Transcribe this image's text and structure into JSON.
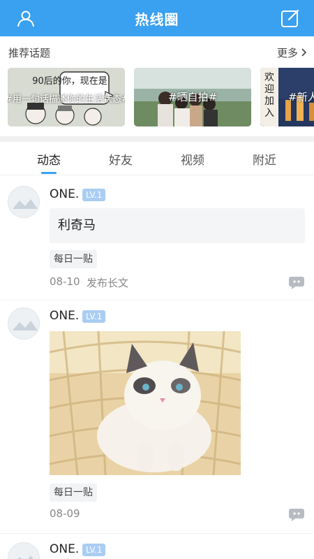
{
  "header": {
    "title": "热线圈",
    "left_icon": "user-icon",
    "right_icon": "compose-icon"
  },
  "topics": {
    "label": "推荐话题",
    "more": "更多",
    "cards": [
      {
        "tag": "#用一句话描述你的生活状态#",
        "art_text": "90后的你，现在是"
      },
      {
        "tag": "#晒自拍#"
      },
      {
        "tag": "#新人",
        "art_text": "欢迎加入"
      }
    ]
  },
  "tabs": [
    "动态",
    "好友",
    "视频",
    "附近"
  ],
  "posts": [
    {
      "username": "ONE.",
      "level": "LV.1",
      "text": "利奇马",
      "chip": "每日一贴",
      "date": "08-10",
      "extra": "发布长文"
    },
    {
      "username": "ONE.",
      "level": "LV.1",
      "chip": "每日一贴",
      "date": "08-09"
    },
    {
      "username": "ONE.",
      "level": "LV.1"
    }
  ],
  "colors": {
    "brand": "#3aa0f0",
    "level_badge": "#a9cdf3"
  }
}
